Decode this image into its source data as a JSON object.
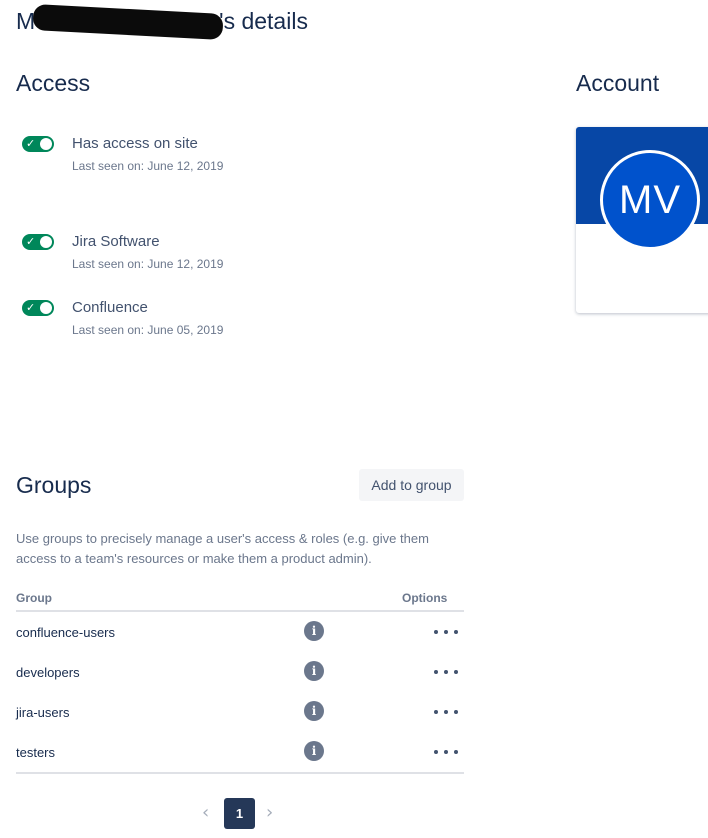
{
  "page": {
    "title_prefix": "M",
    "title_suffix": "'s details"
  },
  "access": {
    "heading": "Access",
    "items": [
      {
        "label": "Has access on site",
        "sub": "Last seen on: June 12, 2019",
        "enabled": true
      },
      {
        "label": "Jira Software",
        "sub": "Last seen on: June 12, 2019",
        "enabled": true
      },
      {
        "label": "Confluence",
        "sub": "Last seen on: June 05, 2019",
        "enabled": true
      }
    ],
    "toggle_color": "#00875a"
  },
  "account": {
    "heading": "Account",
    "avatar_initials": "MV",
    "banner_color": "#0747a6",
    "avatar_color": "#0052cc"
  },
  "groups": {
    "heading": "Groups",
    "add_button": "Add to group",
    "description": "Use groups to precisely manage a user's access & roles (e.g. give them access to a team's resources or make them a product admin).",
    "col_group": "Group",
    "col_options": "Options",
    "rows": [
      {
        "name": "confluence-users",
        "info_icon": "info-icon",
        "options_icon": "more-icon"
      },
      {
        "name": "developers",
        "info_icon": "info-icon",
        "options_icon": "more-icon"
      },
      {
        "name": "jira-users",
        "info_icon": "info-icon",
        "options_icon": "more-icon"
      },
      {
        "name": "testers",
        "info_icon": "info-icon",
        "options_icon": "more-icon"
      }
    ]
  },
  "pagination": {
    "prev_icon": "chevron-left-icon",
    "current": "1",
    "next_icon": "chevron-right-icon",
    "prev_glyph": "‹",
    "next_glyph": "›"
  }
}
